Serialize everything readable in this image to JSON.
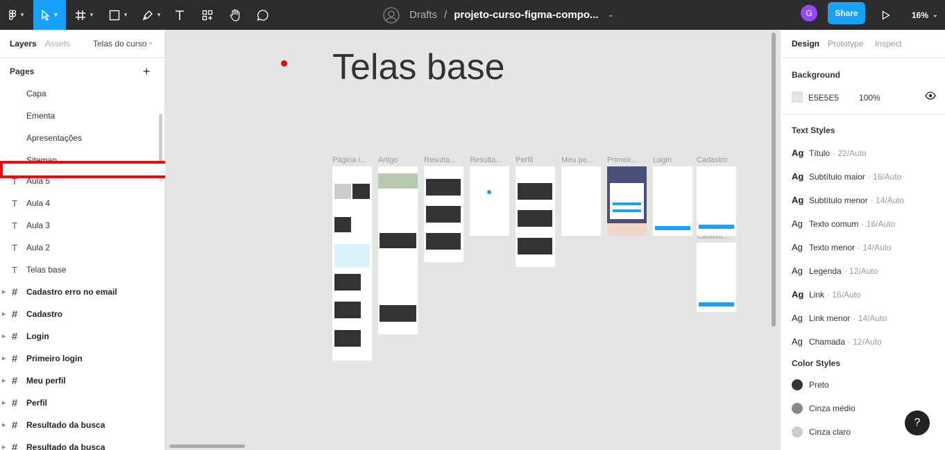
{
  "toolbar": {
    "location": "Drafts",
    "separator": "/",
    "file_name": "projeto-curso-figma-compo...",
    "user_initial": "G",
    "share_label": "Share",
    "zoom": "16%"
  },
  "left_panel": {
    "tabs": [
      "Layers",
      "Assets"
    ],
    "page_selector": "Telas do curso",
    "pages_heading": "Pages",
    "pages": [
      "Capa",
      "Ementa",
      "Apresentações",
      "Sitemap"
    ],
    "layers": [
      {
        "label": "Aula 5",
        "type": "text"
      },
      {
        "label": "Aula 4",
        "type": "text"
      },
      {
        "label": "Aula 3",
        "type": "text"
      },
      {
        "label": "Aula 2",
        "type": "text"
      },
      {
        "label": "Telas base",
        "type": "text"
      },
      {
        "label": "Cadastro erro no email",
        "type": "frame"
      },
      {
        "label": "Cadastro",
        "type": "frame"
      },
      {
        "label": "Login",
        "type": "frame"
      },
      {
        "label": "Primeiro login",
        "type": "frame"
      },
      {
        "label": "Meu perfil",
        "type": "frame"
      },
      {
        "label": "Perfil",
        "type": "frame"
      },
      {
        "label": "Resultado da busca",
        "type": "frame"
      },
      {
        "label": "Resultado da busca",
        "type": "frame"
      }
    ]
  },
  "canvas": {
    "title": "Telas base",
    "frame_labels": [
      "Página i...",
      "Artigo",
      "Resulta...",
      "Resulta...",
      "Perfil",
      "Meu pe...",
      "Primeir...",
      "Login",
      "Cadastro",
      "Cadastr..."
    ]
  },
  "right_panel": {
    "tabs": [
      "Design",
      "Prototype",
      "Inspect"
    ],
    "background_heading": "Background",
    "background_hex": "E5E5E5",
    "background_opacity": "100%",
    "text_styles_heading": "Text Styles",
    "text_styles": [
      {
        "ag": "Ag",
        "name": "Título",
        "meta": "· 22/Auto"
      },
      {
        "ag": "Ag",
        "name": "Subtítulo maior",
        "meta": "· 16/Auto"
      },
      {
        "ag": "Ag",
        "name": "Subtítulo menor",
        "meta": "· 14/Auto"
      },
      {
        "ag": "Ag",
        "name": "Texto comum",
        "meta": "· 16/Auto"
      },
      {
        "ag": "Ag",
        "name": "Texto menor",
        "meta": "· 14/Auto"
      },
      {
        "ag": "Ag",
        "name": "Legenda",
        "meta": "· 12/Auto"
      },
      {
        "ag": "Ag",
        "name": "Link",
        "meta": "· 16/Auto"
      },
      {
        "ag": "Ag",
        "name": "Link menor",
        "meta": "· 14/Auto"
      },
      {
        "ag": "Ag",
        "name": "Chamada",
        "meta": "· 12/Auto"
      }
    ],
    "color_styles_heading": "Color Styles",
    "color_styles": [
      {
        "name": "Preto",
        "color": "#333333"
      },
      {
        "name": "Cinza médio",
        "color": "#888888"
      },
      {
        "name": "Cinza claro",
        "color": "#cccccc"
      }
    ]
  },
  "help_label": "?",
  "colors": {
    "accent": "#18a0fb",
    "toolbar": "#2c2c2c",
    "canvas": "#e5e5e5",
    "highlight": "#ff0000"
  }
}
